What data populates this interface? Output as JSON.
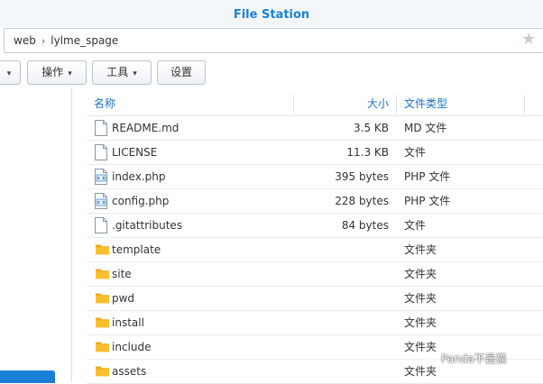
{
  "window": {
    "title": "File Station"
  },
  "path": {
    "segments": [
      "web",
      "lylme_spage"
    ],
    "separator": "›"
  },
  "toolbar": {
    "operate_label": "操作",
    "tools_label": "工具",
    "settings_label": "设置"
  },
  "table": {
    "headers": {
      "name": "名称",
      "size": "大小",
      "type": "文件类型"
    },
    "rows": [
      {
        "icon": "file-icon",
        "name": "README.md",
        "size": "3.5 KB",
        "type": "MD 文件"
      },
      {
        "icon": "file-icon",
        "name": "LICENSE",
        "size": "11.3 KB",
        "type": "文件"
      },
      {
        "icon": "code-file-icon",
        "name": "index.php",
        "size": "395 bytes",
        "type": "PHP 文件"
      },
      {
        "icon": "code-file-icon",
        "name": "config.php",
        "size": "228 bytes",
        "type": "PHP 文件"
      },
      {
        "icon": "file-icon",
        "name": ".gitattributes",
        "size": "84 bytes",
        "type": "文件"
      },
      {
        "icon": "folder-icon",
        "name": "template",
        "size": "",
        "type": "文件夹"
      },
      {
        "icon": "folder-icon",
        "name": "site",
        "size": "",
        "type": "文件夹"
      },
      {
        "icon": "folder-icon",
        "name": "pwd",
        "size": "",
        "type": "文件夹"
      },
      {
        "icon": "folder-icon",
        "name": "install",
        "size": "",
        "type": "文件夹"
      },
      {
        "icon": "folder-icon",
        "name": "include",
        "size": "",
        "type": "文件夹"
      },
      {
        "icon": "folder-icon",
        "name": "assets",
        "size": "",
        "type": "文件夹"
      }
    ]
  },
  "watermark": {
    "text": "Panda不是猫"
  },
  "colors": {
    "accent": "#1a82d6",
    "folder": "#f7b820",
    "selection": "#1b7fd5"
  }
}
